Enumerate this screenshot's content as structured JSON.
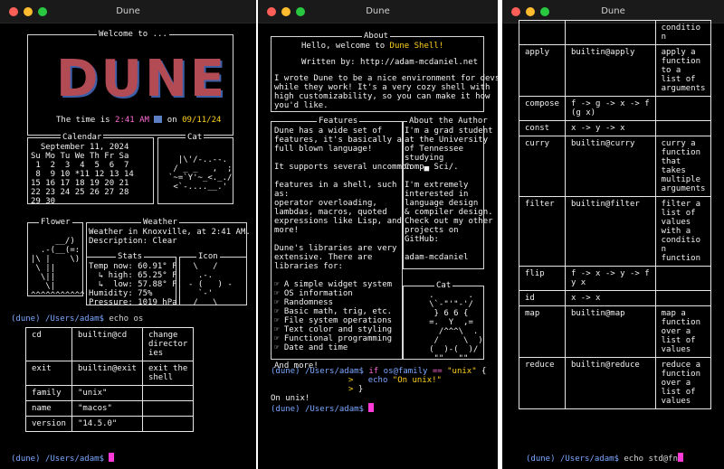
{
  "windows": [
    "Dune",
    "Dune",
    "Dune"
  ],
  "w1": {
    "welcome": "Welcome to ...",
    "logo": "DUNE",
    "time_prefix": "The time is ",
    "time": "2:41 AM",
    "time_on": " on ",
    "date": "09/11/24",
    "calendar": {
      "title": "Calendar",
      "lines": [
        "  September 11, 2024",
        "Su Mo Tu We Th Fr Sa",
        " 1  2  3  4  5  6  7",
        " 8  9 10 *11 12 13 14",
        "15 16 17 18 19 20 21",
        "22 23 24 25 26 27 28",
        "29 30"
      ]
    },
    "cat": {
      "title": "Cat",
      "art": "  |\\'/-..--.\n / _ _   ,  ;\n`~=`Y'~_<._./\n <`-....__.'"
    },
    "flower": {
      "title": "Flower",
      "art": "     __/)\n  .-(__(=:\n|\\ |    \\)\n \\ ||\n  \\||\n   \\|\n^^^^^^^^^^^"
    },
    "weather": {
      "title": "Weather",
      "line1": "Weather in Knoxville, at 2:41 AM.",
      "line2": "Description: Clear",
      "stats_title": "Stats",
      "stats": "Temp now: 60.91° F\n  ↳ high: 65.25° F\n  ↳  low: 57.88° F\nHumidity: 75%\nPressure: 1019 hPa",
      "icon_title": "Icon",
      "icon": " \\   /\n  .-.\n‐ (   ) ‐\n  `-'\n /   \\"
    },
    "prompt_env": "(dune)",
    "prompt_path": "/Users/adam$",
    "cmd": "echo os",
    "table": [
      [
        "cd",
        "builtin@cd",
        "change\ndirector\nies"
      ],
      [
        "exit",
        "builtin@exit",
        "exit the\nshell"
      ],
      [
        "family",
        "\"unix\"",
        ""
      ],
      [
        "name",
        "\"macos\"",
        ""
      ],
      [
        "version",
        "\"14.5.0\"",
        ""
      ]
    ],
    "prompt2_env": "(dune)",
    "prompt2_path": "/Users/adam$"
  },
  "w2": {
    "about_title": "About",
    "hello": "Hello, welcome to ",
    "shell": "Dune Shell!",
    "written": "Written by: http://adam-mcdaniel.net",
    "desc": "I wrote Dune to be a nice environment for devs\nwhile they work! It's a very cozy shell with\nhigh customizability, so you can make it how\nyou'd like.",
    "features_title": "Features",
    "features": "Dune has a wide set of\nfeatures, it's basically a\nfull blown language!\n\nIt supports several uncommon\n\nfeatures in a shell, such\nas:\noperator overloading,\nlambdas, macros, quoted\nexpressions like Lisp, and\nmore!\n\nDune's libraries are very\nextensive. There are\nlibraries for:\n\n☞ A simple widget system\n☞ OS information\n☞ Randomness\n☞ Basic math, trig, etc.\n☞ File system operations\n☞ Text color and styling\n☞ Functional programming\n☞ Date and time\n\nAnd more!",
    "author_title": "About the Author",
    "author": "I'm a grad student\nat the University\nof Tennessee\nstudying\nComp▄ Sci∕.\n\nI'm extremely\ninterested in\nlanguage design\n& compiler design.\nCheck out my other\nprojects on\nGitHub:\n\nadam-mcdaniel",
    "cat2_title": "Cat",
    "cat2": "     .       .\n     \\`-\"'\"-'/\n      } 6 6 {\n     =.  Y  ,=\n       /^^^\\  .\n      /     \\  )\n     (  )-(  )/\n      \"\"   \"\"",
    "prompt_env": "(dune)",
    "prompt_path": "/Users/adam$",
    "cmd_if": "if ",
    "cmd_os": "os@family",
    "cmd_eq": " == ",
    "cmd_unix": "\"unix\"",
    "cmd_brace": " {",
    "echo": "echo ",
    "echo_str": "\"On unix!\"",
    "close": "}",
    "out": "On unix!",
    "prompt2_env": "(dune)",
    "prompt2_path": "/Users/adam$"
  },
  "w3": {
    "table": [
      [
        "",
        "",
        "conditio\nn"
      ],
      [
        "apply",
        "builtin@apply",
        "apply a\nfunction\nto a\nlist of\narguments"
      ],
      [
        "compose",
        "f -> g -> x -> f\n(g x)",
        ""
      ],
      [
        "const",
        "x -> y -> x",
        ""
      ],
      [
        "curry",
        "builtin@curry",
        "curry a\nfunction\nthat\ntakes\nmultiple\narguments"
      ],
      [
        "filter",
        "builtin@filter",
        "filter a\nlist of\nvalues\nwith a\nconditio\nn\nfunction"
      ],
      [
        "flip",
        "f -> x -> y -> f\ny x",
        ""
      ],
      [
        "id",
        "x -> x",
        ""
      ],
      [
        "map",
        "builtin@map",
        "map a\nfunction\nover a\nlist of\nvalues"
      ],
      [
        "reduce",
        "builtin@reduce",
        "reduce a\nfunction\nover a\nlist of\nvalues"
      ]
    ],
    "prompt_env": "(dune)",
    "prompt_path": "/Users/adam$",
    "cmd": "echo std@fn"
  }
}
